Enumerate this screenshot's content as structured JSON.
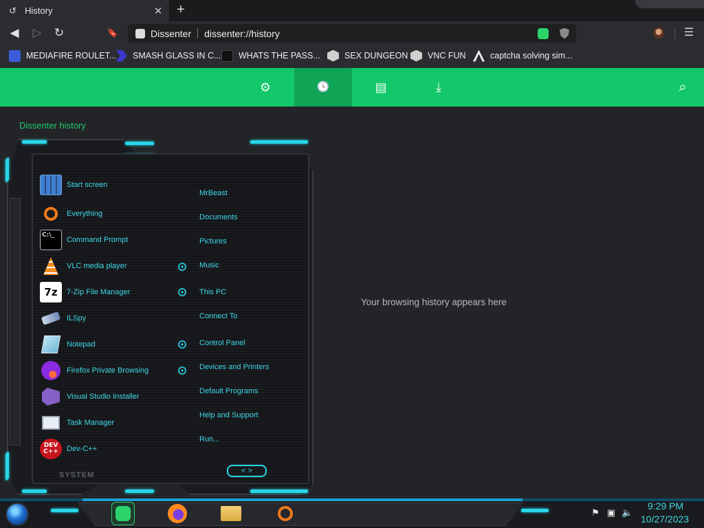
{
  "tab": {
    "title": "History",
    "close": "✕",
    "new_tab": "+"
  },
  "toolbar": {
    "back": "◀",
    "forward": "▷",
    "reload": "↻",
    "bookmark": "🔖",
    "site_name": "Dissenter",
    "url": "dissenter://history",
    "menu": "☰"
  },
  "bookmarks": [
    {
      "label": "MEDIAFIRE ROULET...",
      "color": "#3b5bd9"
    },
    {
      "label": "SMASH GLASS IN C...",
      "color": "#3c37c9"
    },
    {
      "label": "WHATS THE PASS...",
      "color": "#111111"
    },
    {
      "label": "SEX DUNGEON",
      "color": "#d0d0d0"
    },
    {
      "label": "VNC FUN",
      "color": "#cfcfcf"
    },
    {
      "label": "captcha solving sim...",
      "color": "#2b2c2f"
    }
  ],
  "appbar": {
    "settings_icon": "⚙",
    "history_icon": "🕓",
    "saved_icon": "▤",
    "download_icon": "⤓",
    "search_icon": "⌕",
    "accent": "#13c86a"
  },
  "page": {
    "heading": "Dissenter history",
    "empty_text": "Your browsing history appears here"
  },
  "start_menu": {
    "apps": [
      {
        "label": "Start screen",
        "icon": "start-screen-icon"
      },
      {
        "label": "Everything",
        "icon": "magnifier-icon"
      },
      {
        "label": "Command Prompt",
        "icon": "cmd-icon"
      },
      {
        "label": "VLC media player",
        "icon": "vlc-icon"
      },
      {
        "label": "7-Zip File Manager",
        "icon": "7zip-icon"
      },
      {
        "label": "ILSpy",
        "icon": "ilspy-icon"
      },
      {
        "label": "Notepad",
        "icon": "notepad-icon"
      },
      {
        "label": "Firefox Private Browsing",
        "icon": "firefox-private-icon"
      },
      {
        "label": "Visual Studio Installer",
        "icon": "vs-installer-icon"
      },
      {
        "label": "Task Manager",
        "icon": "task-manager-icon"
      },
      {
        "label": "Dev-C++",
        "icon": "devcpp-icon"
      }
    ],
    "links": [
      "MrBeast",
      "Documents",
      "Pictures",
      "Music",
      "This PC",
      "Connect To",
      "Control Panel",
      "Devices and Printers",
      "Default Programs",
      "Help and Support",
      "Run..."
    ],
    "system_label": "SYSTEM",
    "nav_arrows": "< >",
    "icon_texts": {
      "cmd": "C:\\_",
      "zip": "7z",
      "dev": "DEV C++"
    }
  },
  "taskbar": {
    "time": "9:29 PM",
    "date": "10/27/2023"
  }
}
